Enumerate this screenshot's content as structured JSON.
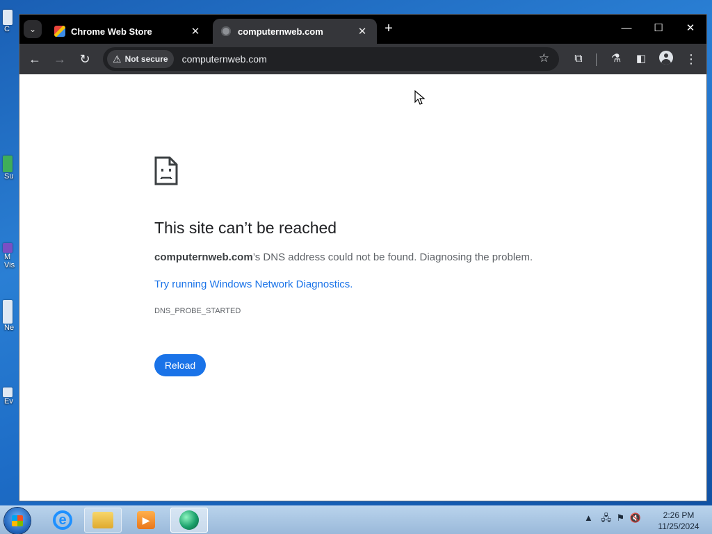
{
  "desktop": {
    "icon_fragments": [
      "C",
      "Su",
      "M",
      "Vis",
      "Ne",
      "Ev"
    ]
  },
  "browser": {
    "tabs": [
      {
        "label": "Chrome Web Store",
        "favicon": "chrome-web-store-icon",
        "active": false
      },
      {
        "label": "computernweb.com",
        "favicon": "globe-icon",
        "active": true
      }
    ],
    "address_bar": {
      "security_label": "Not secure",
      "url": "computernweb.com"
    }
  },
  "page": {
    "title": "This site can’t be reached",
    "desc_domain": "computernweb.com",
    "desc_rest": "’s DNS address could not be found. Diagnosing the problem.",
    "link_text": "Try running Windows Network Diagnostics.",
    "error_code": "DNS_PROBE_STARTED",
    "reload_label": "Reload"
  },
  "taskbar": {
    "time": "2:26 PM",
    "date": "11/25/2024"
  },
  "colors": {
    "accent": "#1a73e8",
    "toolbar": "#35363a",
    "titlebar": "#000000"
  }
}
